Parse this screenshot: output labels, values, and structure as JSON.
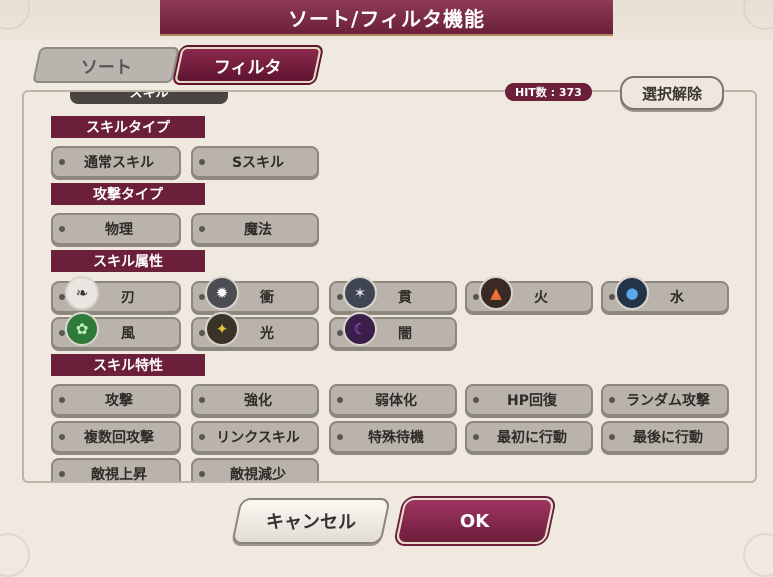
{
  "dialog": {
    "title": "ソート/フィルタ機能"
  },
  "tabs": [
    {
      "label": "ソート",
      "active": false
    },
    {
      "label": "フィルタ",
      "active": true
    }
  ],
  "hit": {
    "label": "HIT数 : 373"
  },
  "clear_button": "選択解除",
  "partial_header": "スキル",
  "sections": [
    {
      "title": "スキルタイプ",
      "options": [
        "通常スキル",
        "Sスキル"
      ]
    },
    {
      "title": "攻撃タイプ",
      "options": [
        "物理",
        "魔法"
      ]
    },
    {
      "title": "スキル属性",
      "options": [
        {
          "label": "刃",
          "icon": "blade-icon",
          "color": "#3a3a3a"
        },
        {
          "label": "衝",
          "icon": "impact-icon",
          "color": "#ffffff"
        },
        {
          "label": "貫",
          "icon": "pierce-icon",
          "color": "#5a6b7a"
        },
        {
          "label": "火",
          "icon": "fire-icon",
          "color": "#e8642a"
        },
        {
          "label": "水",
          "icon": "water-icon",
          "color": "#3a8fd6"
        },
        {
          "label": "風",
          "icon": "wind-icon",
          "color": "#3aa84a"
        },
        {
          "label": "光",
          "icon": "light-icon",
          "color": "#d8b030"
        },
        {
          "label": "闇",
          "icon": "dark-icon",
          "color": "#7a2ab0"
        }
      ]
    },
    {
      "title": "スキル特性",
      "options": [
        "攻撃",
        "強化",
        "弱体化",
        "HP回復",
        "ランダム攻撃",
        "複数回攻撃",
        "リンクスキル",
        "特殊待機",
        "最初に行動",
        "最後に行動",
        "敵視上昇",
        "敵視減少"
      ]
    }
  ],
  "footer": {
    "cancel": "キャンセル",
    "ok": "OK"
  },
  "colors": {
    "accent": "#6b1f3b",
    "chip": "#b9b3ac"
  }
}
